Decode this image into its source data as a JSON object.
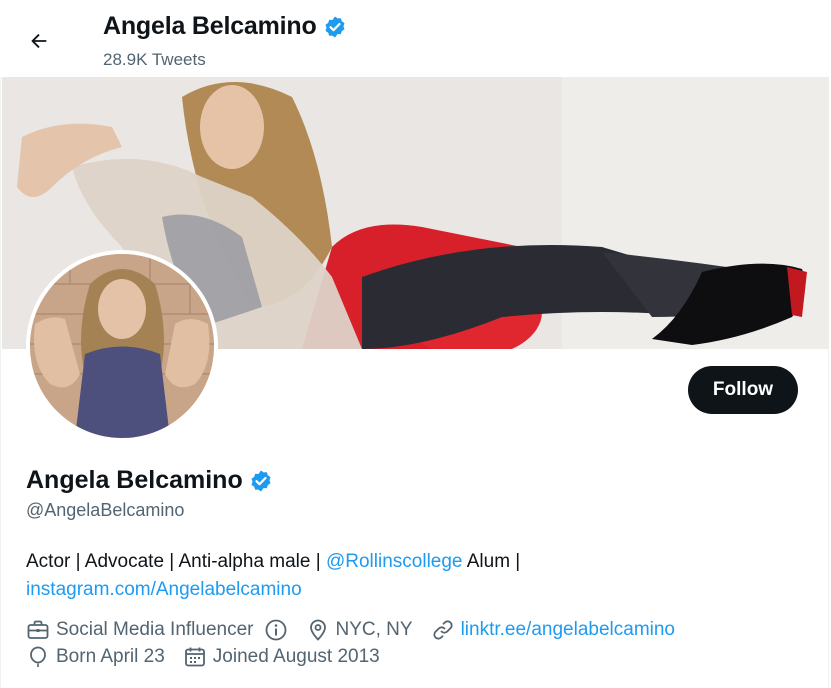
{
  "header": {
    "name": "Angela Belcamino",
    "tweet_count": "28.9K Tweets"
  },
  "profile": {
    "name": "Angela Belcamino",
    "handle": "@AngelaBelcamino",
    "follow_label": "Follow",
    "bio": {
      "text1": "Actor | Advocate | Anti-alpha male | ",
      "mention": "@Rollinscollege",
      "text2": " Alum | ",
      "link": "instagram.com/Angelabelcamino"
    },
    "meta": {
      "category": "Social Media Influencer",
      "location": "NYC, NY",
      "website": "linktr.ee/angelabelcamino",
      "birthday": "Born April 23",
      "joined": "Joined August 2013"
    }
  },
  "colors": {
    "accent": "#1d9bf0",
    "text": "#0f1419",
    "secondary": "#536471",
    "button": "#0f1419"
  },
  "icons": [
    "back-arrow-icon",
    "verified-badge-icon",
    "briefcase-icon",
    "info-icon",
    "location-pin-icon",
    "link-icon",
    "balloon-icon",
    "calendar-icon"
  ]
}
